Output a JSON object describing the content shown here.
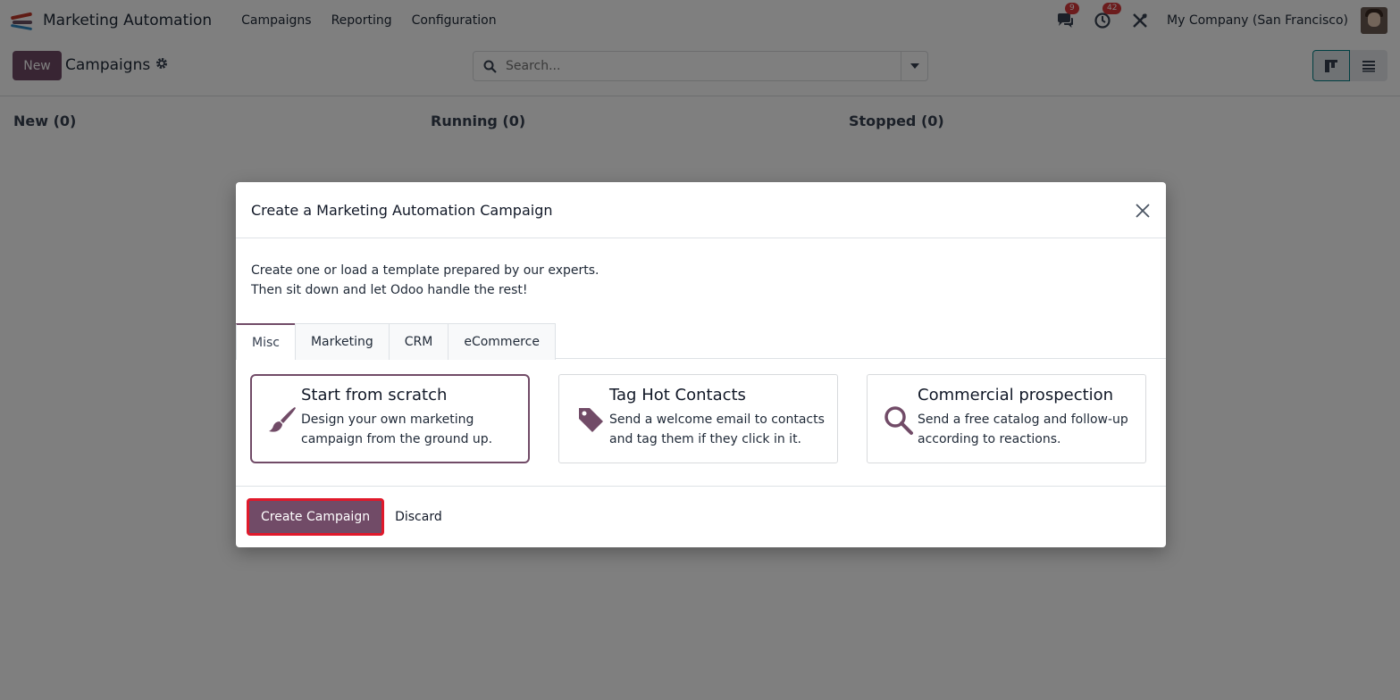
{
  "navbar": {
    "app_title": "Marketing Automation",
    "menu": [
      "Campaigns",
      "Reporting",
      "Configuration"
    ],
    "messages_count": "9",
    "activities_count": "42",
    "company": "My Company (San Francisco)"
  },
  "control": {
    "new_label": "New",
    "breadcrumb": "Campaigns",
    "search_placeholder": "Search..."
  },
  "columns": [
    {
      "label": "New (0)"
    },
    {
      "label": "Running (0)"
    },
    {
      "label": "Stopped (0)"
    }
  ],
  "modal": {
    "title": "Create a Marketing Automation Campaign",
    "intro_line1": "Create one or load a template prepared by our experts.",
    "intro_line2": "Then sit down and let Odoo handle the rest!",
    "tabs": [
      "Misc",
      "Marketing",
      "CRM",
      "eCommerce"
    ],
    "active_tab": "Misc",
    "templates": [
      {
        "title": "Start from scratch",
        "desc_line1": "Design your own marketing",
        "desc_line2": "campaign from the ground up.",
        "icon": "paintbrush-icon"
      },
      {
        "title": "Tag Hot Contacts",
        "desc_line1": "Send a welcome email to contacts",
        "desc_line2": "and tag them if they click in it.",
        "icon": "tag-icon"
      },
      {
        "title": "Commercial prospection",
        "desc_line1": "Send a free catalog and follow-up",
        "desc_line2": "according to reactions.",
        "icon": "search-icon"
      }
    ],
    "create_label": "Create Campaign",
    "discard_label": "Discard"
  },
  "colors": {
    "brand": "#714b67",
    "highlight": "#e0192b",
    "badge": "#d9383a"
  }
}
